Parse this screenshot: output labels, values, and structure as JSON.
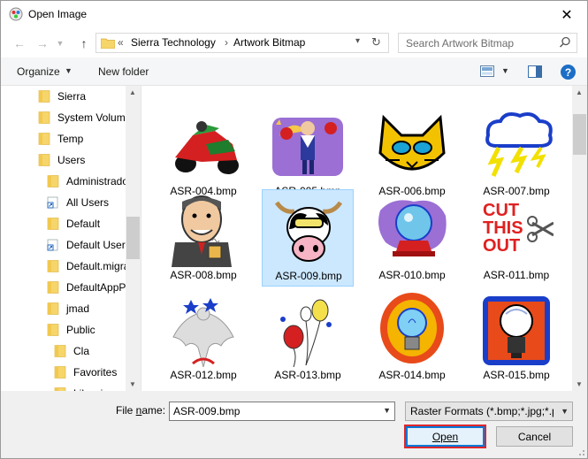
{
  "window": {
    "title": "Open Image"
  },
  "nav": {
    "back_icon": "arrow-left-icon",
    "forward_icon": "arrow-right-icon",
    "recent_icon": "chevron-down-icon",
    "up_icon": "arrow-up-icon",
    "address_prefix": "«",
    "breadcrumbs": [
      "Sierra Technology",
      "Artwork Bitmap"
    ],
    "breadcrumb_sep": "›",
    "search_placeholder": "Search Artwork Bitmap"
  },
  "toolbar": {
    "organize_label": "Organize",
    "new_folder_label": "New folder",
    "help_label": "?"
  },
  "tree": {
    "items": [
      {
        "label": "Sierra",
        "type": "folder"
      },
      {
        "label": "System Volume",
        "type": "folder"
      },
      {
        "label": "Temp",
        "type": "folder"
      },
      {
        "label": "Users",
        "type": "folder"
      },
      {
        "label": "Administrado",
        "type": "folder"
      },
      {
        "label": "All Users",
        "type": "shortcut"
      },
      {
        "label": "Default",
        "type": "folder"
      },
      {
        "label": "Default User",
        "type": "shortcut"
      },
      {
        "label": "Default.migra",
        "type": "folder"
      },
      {
        "label": "DefaultAppPo",
        "type": "folder"
      },
      {
        "label": "jmad",
        "type": "folder"
      },
      {
        "label": "Public",
        "type": "folder"
      },
      {
        "label": "Cla",
        "type": "folder"
      },
      {
        "label": "Favorites",
        "type": "folder"
      },
      {
        "label": "Libraries",
        "type": "folder"
      }
    ]
  },
  "files": [
    {
      "name": "ASR-004.bmp",
      "art": "motorcycle"
    },
    {
      "name": "ASR-005.bmp",
      "art": "boxer"
    },
    {
      "name": "ASR-006.bmp",
      "art": "cat"
    },
    {
      "name": "ASR-007.bmp",
      "art": "storm"
    },
    {
      "name": "ASR-008.bmp",
      "art": "man-coffee"
    },
    {
      "name": "ASR-009.bmp",
      "art": "cow",
      "selected": true
    },
    {
      "name": "ASR-010.bmp",
      "art": "crystal-ball"
    },
    {
      "name": "ASR-011.bmp",
      "art": "cut-this-out"
    },
    {
      "name": "ASR-012.bmp",
      "art": "eagle"
    },
    {
      "name": "ASR-013.bmp",
      "art": "balloons"
    },
    {
      "name": "ASR-014.bmp",
      "art": "bulb-orange"
    },
    {
      "name": "ASR-015.bmp",
      "art": "bulb-blue"
    }
  ],
  "art_text": {
    "cut_line1": "CUT",
    "cut_line2": "THIS",
    "cut_line3": "OUT"
  },
  "bottom": {
    "file_name_label_pre": "File ",
    "file_name_label_ul": "n",
    "file_name_label_post": "ame:",
    "file_name_value": "ASR-009.bmp",
    "file_type_value": "Raster Formats (*.bmp;*.jpg;*.p",
    "open_label": "Open",
    "cancel_label": "Cancel"
  },
  "colors": {
    "accent": "#0078d7",
    "selection": "#cce8ff",
    "highlight_outline": "#e0262b",
    "folder": "#f6d56a"
  }
}
